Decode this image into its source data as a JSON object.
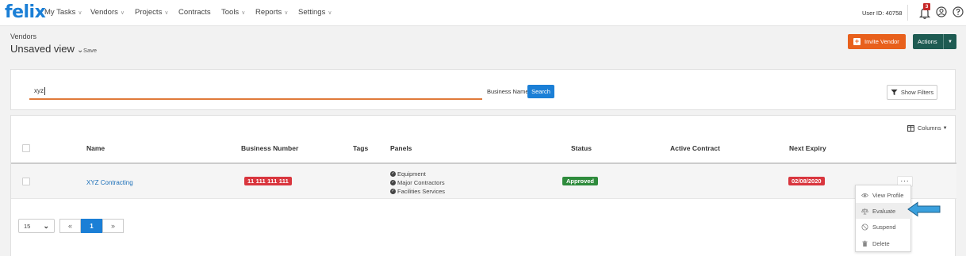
{
  "app": {
    "logo": "felix"
  },
  "nav": {
    "items": [
      {
        "label": "My Tasks",
        "chevron": true
      },
      {
        "label": "Vendors",
        "chevron": true
      },
      {
        "label": "Projects",
        "chevron": true
      },
      {
        "label": "Contracts",
        "chevron": false
      },
      {
        "label": "Tools",
        "chevron": true
      },
      {
        "label": "Reports",
        "chevron": true
      },
      {
        "label": "Settings",
        "chevron": true
      }
    ],
    "user_id": "User ID: 40758",
    "notification_count": "3"
  },
  "header": {
    "breadcrumb": "Vendors",
    "view_title": "Unsaved view",
    "save_label": "Save",
    "invite_label": "Invite Vendor",
    "actions_label": "Actions"
  },
  "search": {
    "value": "xyz",
    "field_select": "Business Name",
    "search_label": "Search",
    "show_filters_label": "Show Filters"
  },
  "table": {
    "columns_label": "Columns",
    "headers": {
      "name": "Name",
      "business_number": "Business Number",
      "tags": "Tags",
      "panels": "Panels",
      "status": "Status",
      "active_contract": "Active Contract",
      "next_expiry": "Next Expiry"
    },
    "rows": [
      {
        "name": "XYZ Contracting",
        "business_number": "11 111 111 111",
        "tags": "",
        "panels": [
          "Equipment",
          "Major Contractors",
          "Facilities Services"
        ],
        "status": "Approved",
        "active_contract": "",
        "next_expiry": "02/08/2020",
        "more": "..."
      }
    ]
  },
  "pagination": {
    "page_size": "15",
    "prev": "«",
    "current_page": "1",
    "next": "»"
  },
  "row_menu": {
    "items": [
      {
        "label": "View Profile",
        "icon": "eye-icon"
      },
      {
        "label": "Evaluate",
        "icon": "scale-icon"
      },
      {
        "label": "Suspend",
        "icon": "ban-icon"
      },
      {
        "label": "Delete",
        "icon": "trash-icon"
      }
    ]
  },
  "colors": {
    "brand_blue": "#1b7fd6",
    "invite_orange": "#e8601c",
    "actions_green": "#1e5b52",
    "status_green": "#2e8b3c",
    "alert_red": "#d9363e",
    "annotation_arrow": "#3aa0dd"
  }
}
